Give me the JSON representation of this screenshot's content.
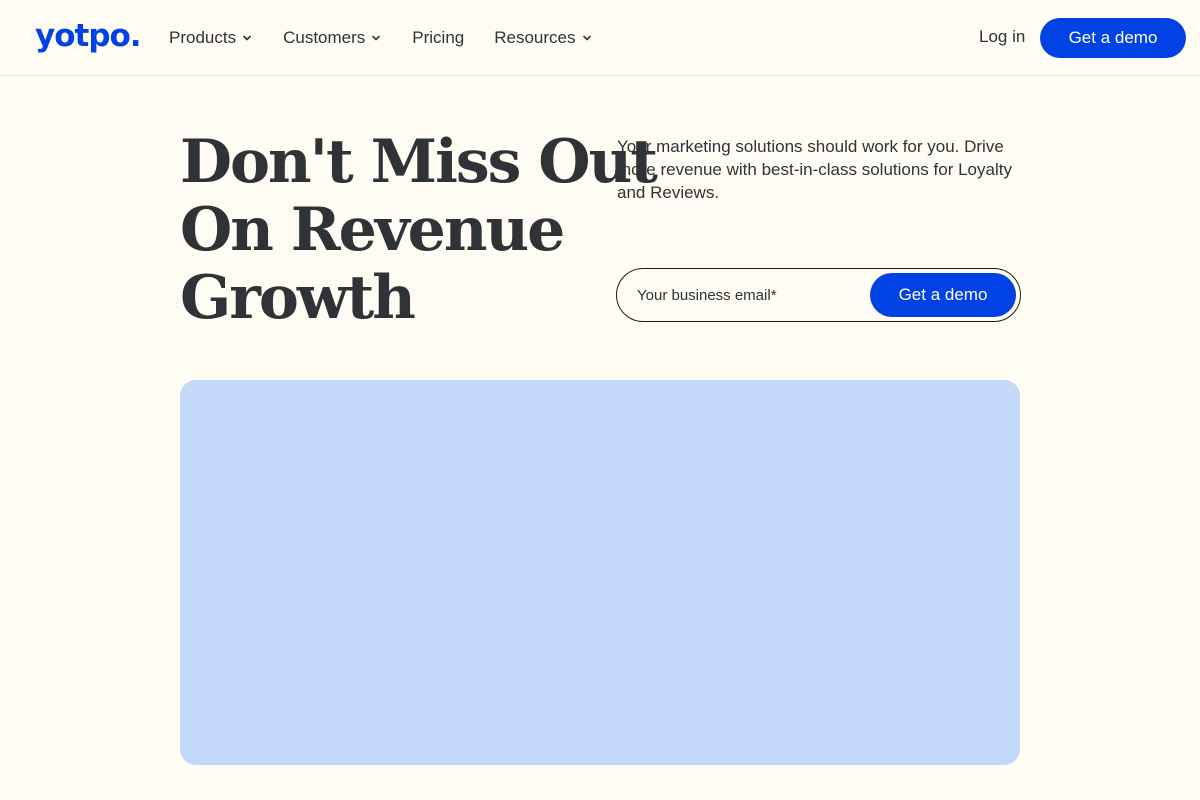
{
  "header": {
    "logo_text": "yotpo.",
    "nav": [
      {
        "label": "Products",
        "has_dropdown": true
      },
      {
        "label": "Customers",
        "has_dropdown": true
      },
      {
        "label": "Pricing",
        "has_dropdown": false
      },
      {
        "label": "Resources",
        "has_dropdown": true
      }
    ],
    "login_label": "Log in",
    "demo_label": "Get a demo"
  },
  "hero": {
    "title_lines": [
      "Don't Miss Out",
      "On Revenue",
      "Growth"
    ],
    "description": "Your marketing solutions should work for you. Drive more revenue with best-in-class solutions for Loyalty and Reviews.",
    "email_placeholder": "Your business email*",
    "email_value": "",
    "submit_label": "Get a demo"
  },
  "colors": {
    "brand": "#0042e4",
    "background": "#fffcf3",
    "text": "#2f3337",
    "media_panel": "#c3d9fa"
  },
  "icons": {
    "dropdown": "chevron-down-icon"
  }
}
